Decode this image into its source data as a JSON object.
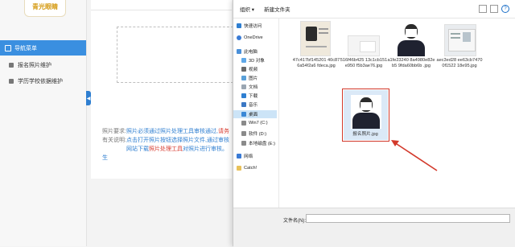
{
  "sidebar": {
    "logo_text": "青光眼睛",
    "items": [
      {
        "label": "导航菜单",
        "active": true
      },
      {
        "label": "报名照片维护"
      },
      {
        "label": "学历学校依据维护"
      }
    ],
    "collapse_icon": "chevron-left-icon"
  },
  "content": {
    "requirements_label": "照片要求:",
    "requirements_text_1": "照片必须通过照片处理工具审核通过,",
    "requirements_text_1b": "请务",
    "description_label": "有关说明:",
    "line2": "点击打开照片按钮选择照片文件,通过审核",
    "line3a": "网站下载",
    "line3b": "照片处理工具",
    "line3c": "对照片进行审核。生"
  },
  "dialog": {
    "toolbar": {
      "organize": "组织 ▾",
      "new_folder": "新建文件夹"
    },
    "nav": [
      {
        "label": "快速访问",
        "icon": "star-icon",
        "level": 0
      },
      {
        "label": "OneDrive",
        "icon": "cloud-icon",
        "level": 0
      },
      {
        "label": "此电脑",
        "icon": "computer-icon",
        "level": 0
      },
      {
        "label": "3D 对象",
        "icon": "cube-icon",
        "level": 1
      },
      {
        "label": "视频",
        "icon": "video-icon",
        "level": 1
      },
      {
        "label": "图片",
        "icon": "picture-icon",
        "level": 1
      },
      {
        "label": "文档",
        "icon": "document-icon",
        "level": 1
      },
      {
        "label": "下载",
        "icon": "download-icon",
        "level": 1
      },
      {
        "label": "音乐",
        "icon": "music-icon",
        "level": 1
      },
      {
        "label": "桌面",
        "icon": "desktop-icon",
        "level": 1,
        "selected": true
      },
      {
        "label": "Win7 (C:)",
        "icon": "drive-icon",
        "level": 1
      },
      {
        "label": "软件 (D:)",
        "icon": "drive-icon",
        "level": 1
      },
      {
        "label": "本地磁盘 (E:)",
        "icon": "drive-icon",
        "level": 1
      },
      {
        "label": "网络",
        "icon": "network-icon",
        "level": 0
      },
      {
        "label": "Catch!",
        "icon": "folder-icon",
        "level": 0
      }
    ],
    "files": [
      {
        "name": "47c417bf145201 40c876a54f2a6 fdeca.jpg",
        "kind": "card"
      },
      {
        "name": "516f46b425 13c1cb151e950 f5b3ae76.jpg",
        "kind": "blank"
      },
      {
        "name": "a1fe23240 8a4980e82eb5 9fda60bb6b .jpg",
        "kind": "person"
      },
      {
        "name": "aec3ed28 ee63cb7470 0f1522 18e95.jpg",
        "kind": "card2"
      },
      {
        "name": "报名照片.jpg",
        "kind": "person",
        "selected": true
      }
    ],
    "filename_label": "文件名(N):",
    "filename_value": ""
  }
}
